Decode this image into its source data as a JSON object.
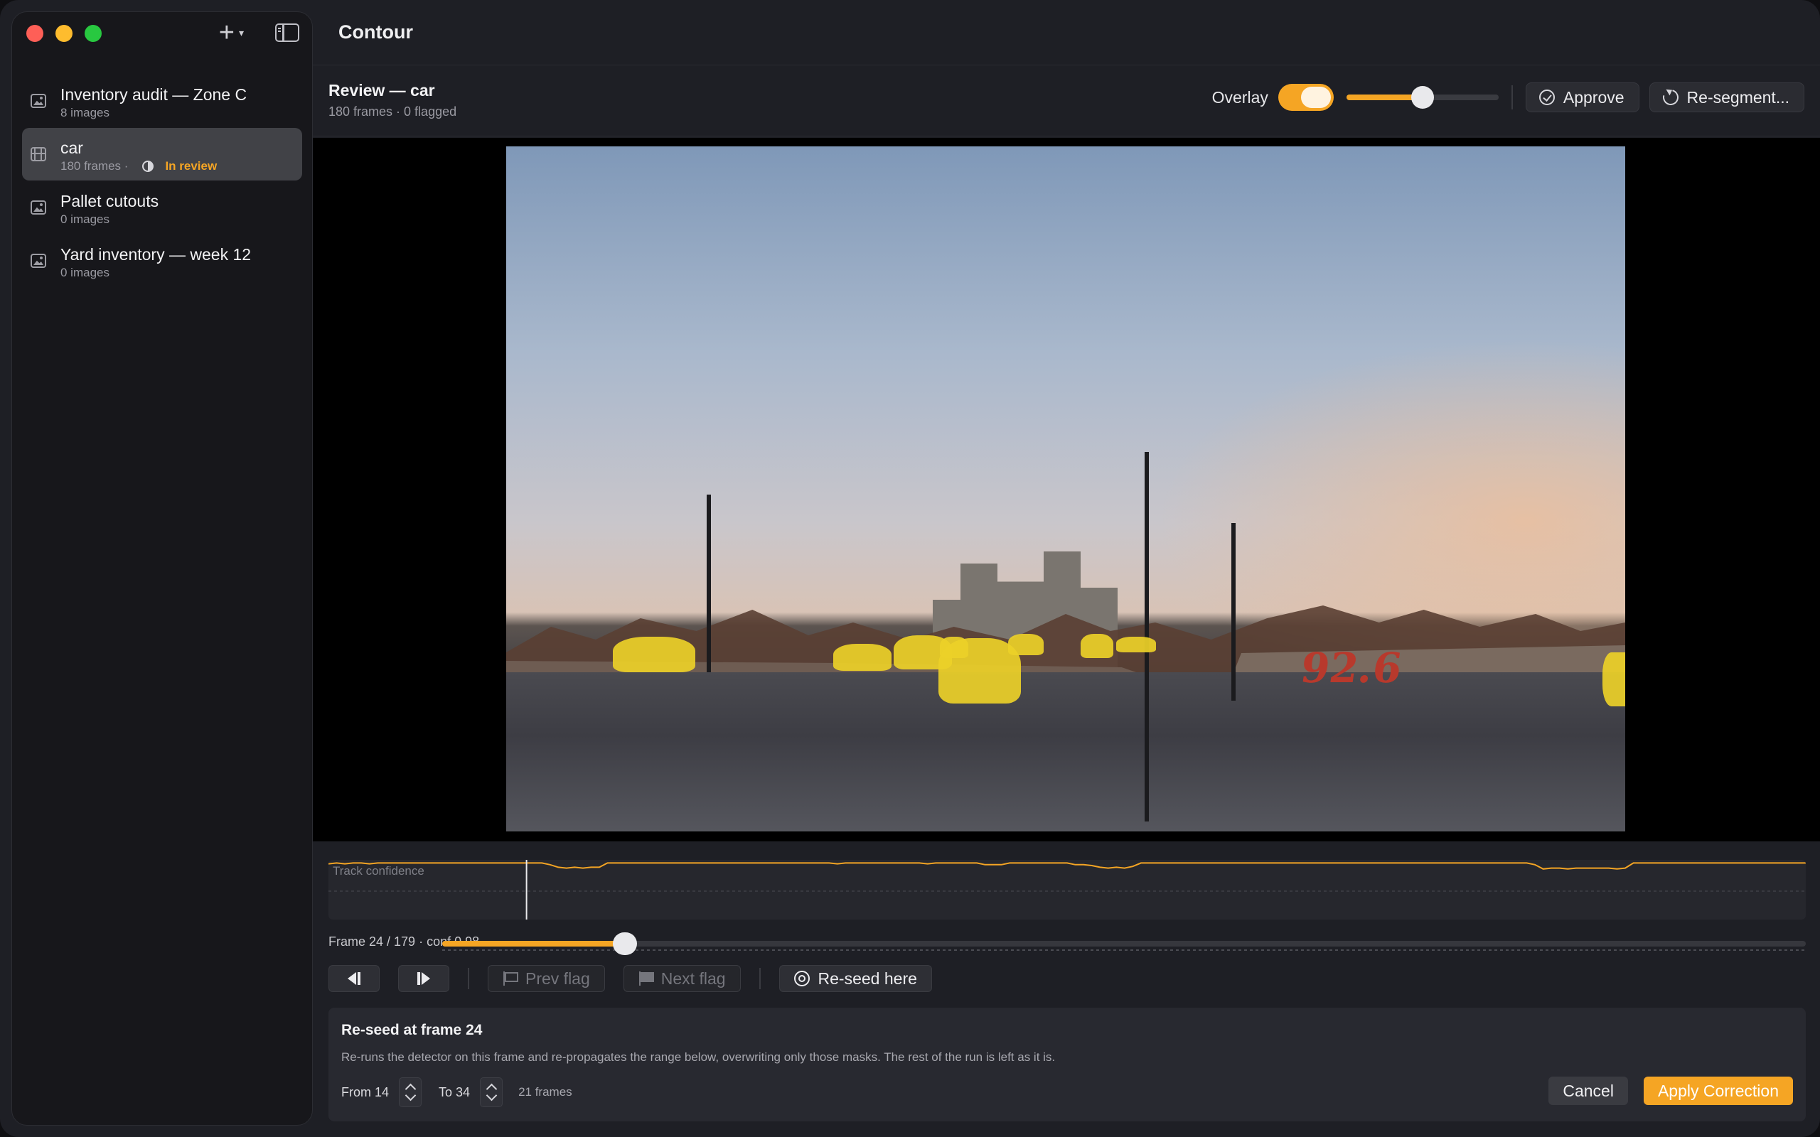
{
  "app": {
    "title": "Contour"
  },
  "sidebar": {
    "items": [
      {
        "name": "Inventory audit — Zone C",
        "sub": "8 images",
        "icon": "image-stack-icon"
      },
      {
        "name": "car",
        "sub": "180 frames ·",
        "status": "In review",
        "icon": "film-icon",
        "active": true
      },
      {
        "name": "Pallet cutouts",
        "sub": "0 images",
        "icon": "image-stack-icon"
      },
      {
        "name": "Yard inventory — week 12",
        "sub": "0 images",
        "icon": "image-stack-icon"
      }
    ]
  },
  "header": {
    "title": "Review — car",
    "subtitle": "180 frames · 0 flagged",
    "overlay_label": "Overlay",
    "overlay_on": true,
    "opacity_value": 0.5,
    "approve_label": "Approve",
    "resegment_label": "Re-segment..."
  },
  "timeline": {
    "label": "Track confidence",
    "confidence": [
      0.97,
      0.98,
      0.97,
      0.98,
      0.98,
      0.97,
      0.98,
      0.98,
      0.98,
      0.98,
      0.98,
      0.98,
      0.98,
      0.98,
      0.98,
      0.98,
      0.98,
      0.98,
      0.98,
      0.98,
      0.98,
      0.98,
      0.98,
      0.98,
      0.98,
      0.98,
      0.98,
      0.96,
      0.93,
      0.92,
      0.93,
      0.92,
      0.93,
      0.93,
      0.98,
      0.98,
      0.98,
      0.98,
      0.98,
      0.98,
      0.98,
      0.98,
      0.98,
      0.98,
      0.98,
      0.98,
      0.98,
      0.98,
      0.98,
      0.98,
      0.98,
      0.98,
      0.98,
      0.98,
      0.98,
      0.98,
      0.98,
      0.98,
      0.98,
      0.98,
      0.98,
      0.98,
      0.97,
      0.98,
      0.98,
      0.98,
      0.98,
      0.98,
      0.98,
      0.98,
      0.98,
      0.98,
      0.98,
      0.97,
      0.98,
      0.98,
      0.98,
      0.98,
      0.98,
      0.98,
      0.96,
      0.96,
      0.96,
      0.98,
      0.98,
      0.98,
      0.98,
      0.98,
      0.98,
      0.98,
      0.98,
      0.96,
      0.96,
      0.95,
      0.93,
      0.92,
      0.93,
      0.92,
      0.94,
      0.98,
      0.98,
      0.98,
      0.98,
      0.98,
      0.98,
      0.98,
      0.98,
      0.98,
      0.98,
      0.98,
      0.98,
      0.98,
      0.98,
      0.98,
      0.98,
      0.98,
      0.98,
      0.98,
      0.98,
      0.98,
      0.98,
      0.98,
      0.98,
      0.98,
      0.98,
      0.98,
      0.98,
      0.98,
      0.98,
      0.98,
      0.98,
      0.98,
      0.98,
      0.98,
      0.98,
      0.98,
      0.98,
      0.98,
      0.98,
      0.98,
      0.98,
      0.98,
      0.98,
      0.98,
      0.98,
      0.98,
      0.98,
      0.96,
      0.91,
      0.92,
      0.92,
      0.91,
      0.92,
      0.92,
      0.92,
      0.92,
      0.92,
      0.91,
      0.92,
      0.98,
      0.98,
      0.98,
      0.98,
      0.98,
      0.98,
      0.98,
      0.98,
      0.98,
      0.98,
      0.98,
      0.98,
      0.98,
      0.98,
      0.98,
      0.98,
      0.98,
      0.98,
      0.98,
      0.98,
      0.98,
      0.98
    ],
    "current_frame": 24,
    "last_frame": 179
  },
  "scrubber": {
    "frame_label": "Frame 24 / 179",
    "conf_label": "conf 0.98"
  },
  "controls": {
    "prev_flag": "Prev flag",
    "next_flag": "Next flag",
    "reseed": "Re-seed here"
  },
  "reseed_panel": {
    "title": "Re-seed at frame 24",
    "description": "Re-runs the detector on this frame and re-propagates the range below, overwriting only those masks. The rest of the run is left as it is.",
    "from_label": "From 14",
    "to_label": "To 34",
    "count_label": "21 frames",
    "cancel": "Cancel",
    "apply": "Apply Correction"
  },
  "colors": {
    "accent": "#f5a524",
    "mask": "#ecd028"
  }
}
